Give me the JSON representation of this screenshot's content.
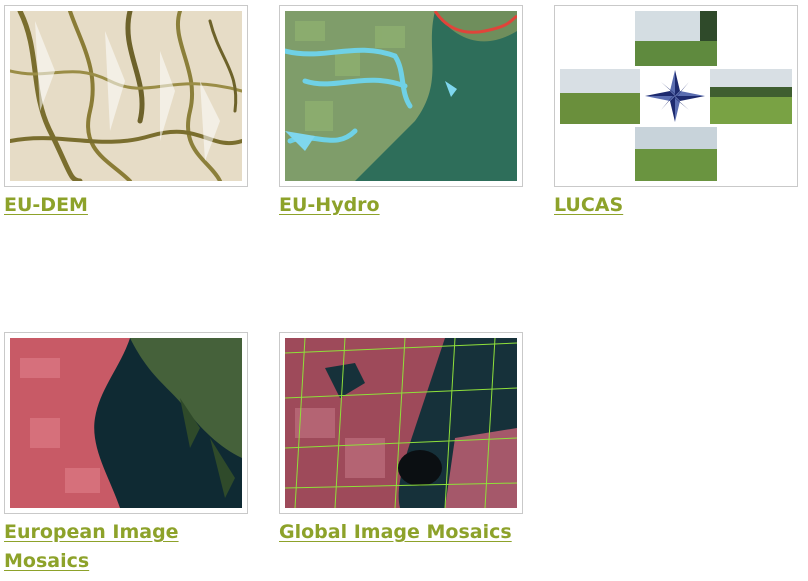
{
  "products": [
    {
      "label": "EU-DEM",
      "image": "shaded-relief-terrain"
    },
    {
      "label": "EU-Hydro",
      "image": "river-network-satellite"
    },
    {
      "label": "LUCAS",
      "image": "field-photos-compass-rose"
    },
    {
      "label": "European Image Mosaics",
      "image": "false-color-coastline"
    },
    {
      "label": "Global Image Mosaics",
      "image": "false-color-scene-grid"
    }
  ],
  "colors": {
    "link": "#8da22a",
    "border": "#c9c9c9"
  }
}
